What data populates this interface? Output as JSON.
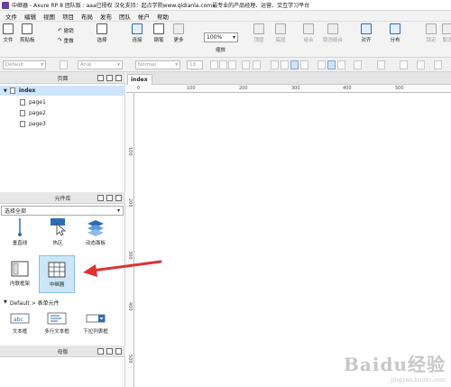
{
  "title": "中继器 - Axure RP 8 团队版 : aaa已授权 汉化支持：起点学院www.qidianla.com最专业的产品经理、运营、交互学习平台",
  "menu": [
    "文件",
    "编辑",
    "视图",
    "项目",
    "布局",
    "发布",
    "团队",
    "帐户",
    "帮助"
  ],
  "toolbar": {
    "file": "文件",
    "clipboard": "剪贴板",
    "undo": "撤销",
    "redo": "重做",
    "select": "选择",
    "connect": "连接",
    "pen": "钢笔",
    "more": "更多",
    "zoom_value": "100%",
    "zoom": "缩放",
    "top_layer": "顶层",
    "bottom_layer": "底层",
    "group": "组合",
    "ungroup": "取消组合",
    "align": "对齐",
    "distribute": "分布",
    "lock": "锁定",
    "unlock": "取消"
  },
  "format": {
    "style": "Default",
    "font": "Arial",
    "weight": "Normal",
    "size": "13"
  },
  "pages_panel": {
    "title": "页面",
    "root": "index",
    "children": [
      "page1",
      "page2",
      "page3"
    ]
  },
  "library_panel": {
    "title": "元件库",
    "select_all": "选择全部",
    "widgets_row1": [
      "垂直线",
      "热区",
      "动态面板"
    ],
    "widgets_row2": [
      "内联框架",
      "中继器"
    ],
    "section": "Default > 表单元件",
    "widgets_row3": [
      "文本框",
      "多行文本框",
      "下拉列表框"
    ]
  },
  "masters_panel": {
    "title": "母版"
  },
  "editor": {
    "tab": "index",
    "ruler_top": [
      "0",
      "100",
      "200",
      "300",
      "400",
      "500"
    ],
    "ruler_left": [
      "100",
      "200",
      "300",
      "400",
      "500"
    ]
  },
  "watermark": {
    "logo": "Baidu经验",
    "url": "jingyan.baidu.com"
  },
  "colors": {
    "selection": "#cde6f7",
    "arrow": "#e0312f",
    "brand": "#6b3fa0"
  }
}
